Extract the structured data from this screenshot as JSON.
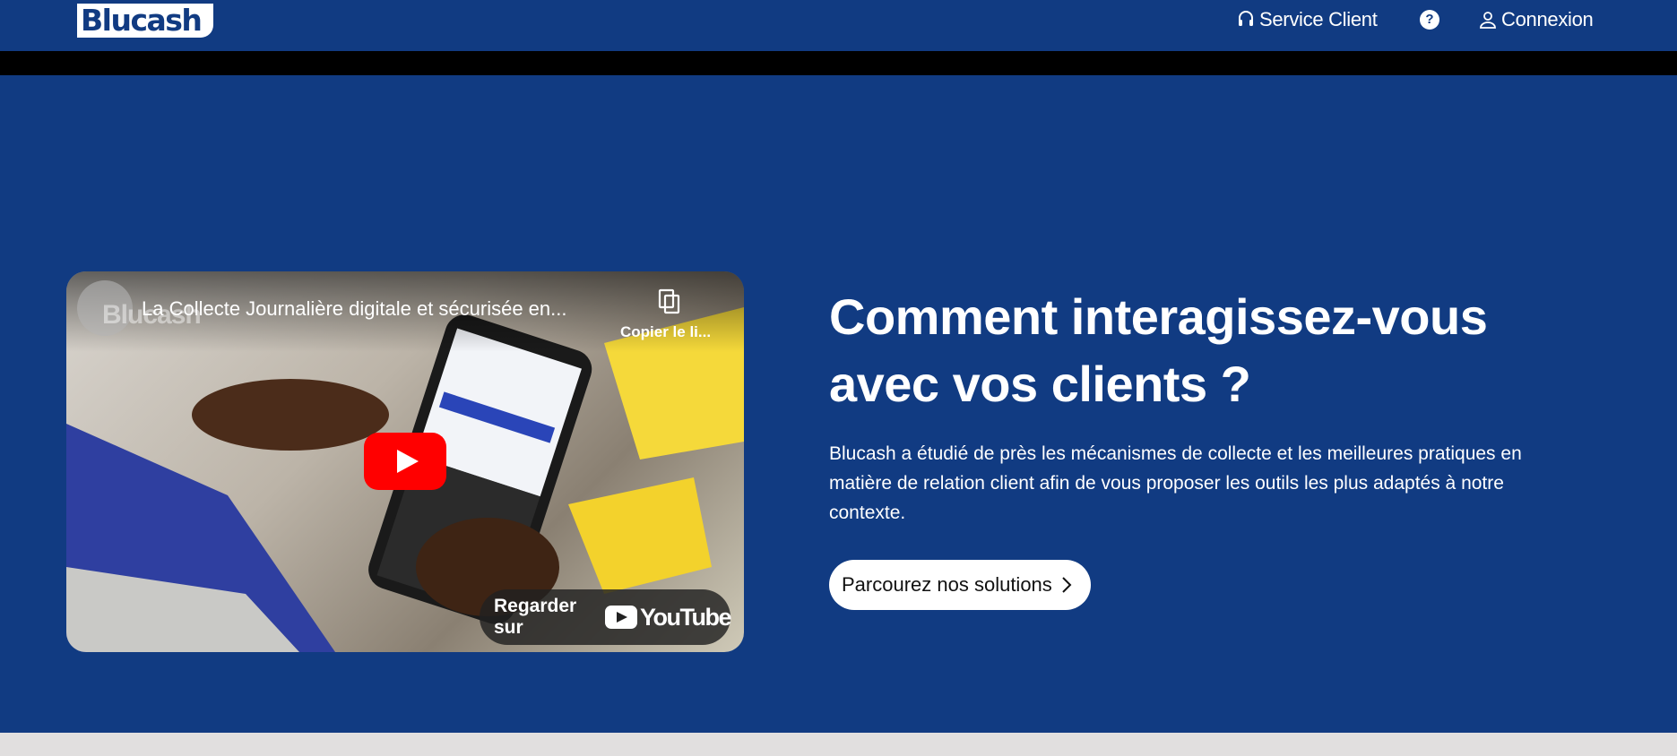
{
  "header": {
    "logo_text": "Blucash",
    "nav": {
      "service_client": "Service Client",
      "help_symbol": "?",
      "connexion": "Connexion"
    },
    "icons": [
      "headset-icon",
      "help-icon",
      "user-icon"
    ]
  },
  "video": {
    "title": "La Collecte Journalière digitale et sécurisée en...",
    "channel_watermark": "Blucash",
    "copy_link_label": "Copier le li...",
    "watch_on_label": "Regarder sur",
    "youtube_label": "YouTube"
  },
  "hero": {
    "title": "Comment interagissez-vous avec vos clients ?",
    "description": "Blucash a étudié de près les mécanismes de collecte et les meilleures pratiques en matière de relation client afin de vous proposer les outils les plus adaptés à notre contexte.",
    "cta_label": "Parcourez nos solutions"
  },
  "colors": {
    "brand_blue": "#113b82",
    "youtube_red": "#ff0000",
    "white": "#ffffff"
  }
}
